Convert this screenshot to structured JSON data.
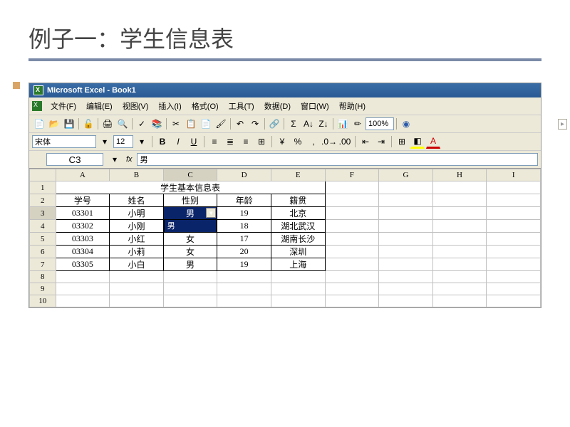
{
  "slide": {
    "title": "例子一：学生信息表"
  },
  "window": {
    "title": "Microsoft Excel - Book1"
  },
  "menus": {
    "file": "文件(F)",
    "edit": "编辑(E)",
    "view": "视图(V)",
    "insert": "插入(I)",
    "format": "格式(O)",
    "tools": "工具(T)",
    "data": "数据(D)",
    "window_m": "窗口(W)",
    "help": "帮助(H)"
  },
  "format_toolbar": {
    "font_name": "宋体",
    "font_size": "12",
    "zoom": "100%",
    "bold": "B",
    "italic": "I",
    "underline": "U",
    "currency": "¥",
    "percent": "%",
    "comma": ",",
    "inc_dec": ".0",
    "dec_dec": ".00"
  },
  "formula_bar": {
    "cell_ref": "C3",
    "fx": "fx",
    "value": "男"
  },
  "columns": [
    "A",
    "B",
    "C",
    "D",
    "E",
    "F",
    "G",
    "H",
    "I"
  ],
  "row_numbers": [
    1,
    2,
    3,
    4,
    5,
    6,
    7,
    8,
    9,
    10
  ],
  "table": {
    "title": "学生基本信息表",
    "headers": {
      "id": "学号",
      "name": "姓名",
      "gender": "性别",
      "age": "年龄",
      "origin": "籍贯"
    },
    "rows": [
      {
        "id": "03301",
        "name": "小明",
        "gender": "男",
        "age": "19",
        "origin": "北京"
      },
      {
        "id": "03302",
        "name": "小刚",
        "gender": "",
        "age": "18",
        "origin": "湖北武汉"
      },
      {
        "id": "03303",
        "name": "小红",
        "gender": "女",
        "age": "17",
        "origin": "湖南长沙"
      },
      {
        "id": "03304",
        "name": "小莉",
        "gender": "女",
        "age": "20",
        "origin": "深圳"
      },
      {
        "id": "03305",
        "name": "小白",
        "gender": "男",
        "age": "19",
        "origin": "上海"
      }
    ]
  },
  "dropdown": {
    "opt1": "男",
    "opt2": "女"
  }
}
